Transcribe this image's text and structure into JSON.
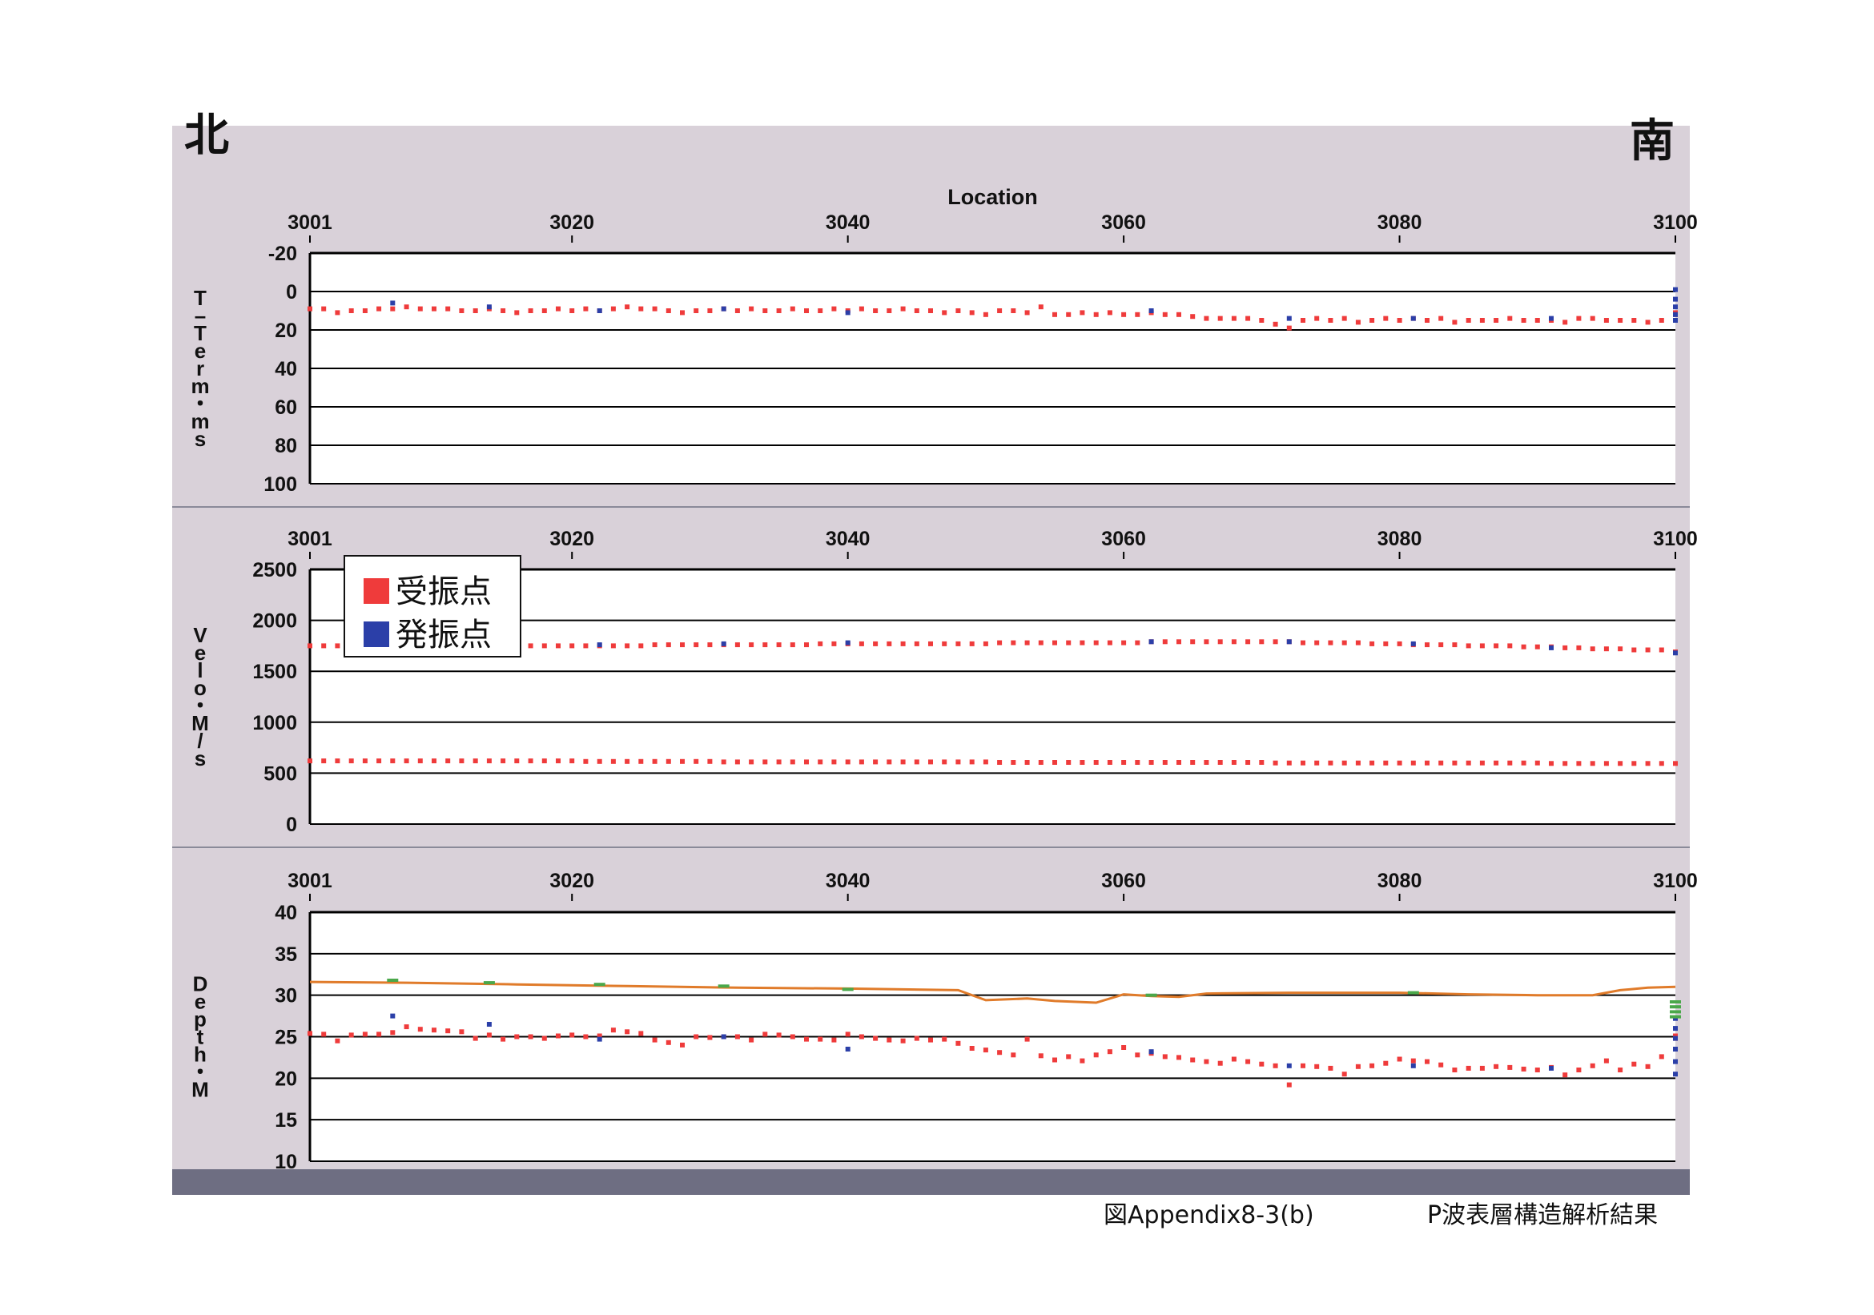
{
  "header": {
    "north_label": "北",
    "south_label": "南"
  },
  "caption": {
    "figure_id": "図Appendix8-3(b)",
    "figure_title": "P波表層構造解析結果"
  },
  "legend": {
    "items": [
      {
        "label": "受振点",
        "color": "#ef3b3b"
      },
      {
        "label": "発振点",
        "color": "#2b3fa8"
      }
    ]
  },
  "colors": {
    "receiver": "#ef3b3b",
    "shot": "#2b3fa8",
    "surface_line": "#e07b2a",
    "surface_marker": "#4aa84a",
    "panel_bg": "#d9d1d9",
    "plot_bg": "#ffffff",
    "footer_bar": "#6e6e82"
  },
  "chart_data": [
    {
      "type": "scatter",
      "title": "",
      "xlabel": "Location",
      "ylabel": "T-Term・ms",
      "x_ticks": [
        3001,
        3020,
        3040,
        3060,
        3080,
        3100
      ],
      "xlim": [
        3001,
        3100
      ],
      "y_ticks": [
        -20,
        0,
        20,
        40,
        60,
        80,
        100
      ],
      "ylim": [
        -20,
        100
      ],
      "y_inverted": true,
      "grid": true,
      "series": [
        {
          "name": "受振点",
          "x": [
            3001,
            3002,
            3003,
            3004,
            3005,
            3006,
            3007,
            3008,
            3009,
            3010,
            3011,
            3012,
            3013,
            3014,
            3015,
            3016,
            3017,
            3018,
            3019,
            3020,
            3021,
            3022,
            3023,
            3024,
            3025,
            3026,
            3027,
            3028,
            3029,
            3030,
            3031,
            3032,
            3033,
            3034,
            3035,
            3036,
            3037,
            3038,
            3039,
            3040,
            3041,
            3042,
            3043,
            3044,
            3045,
            3046,
            3047,
            3048,
            3049,
            3050,
            3051,
            3052,
            3053,
            3054,
            3055,
            3056,
            3057,
            3058,
            3059,
            3060,
            3061,
            3062,
            3063,
            3064,
            3065,
            3066,
            3067,
            3068,
            3069,
            3070,
            3071,
            3072,
            3073,
            3074,
            3075,
            3076,
            3077,
            3078,
            3079,
            3080,
            3081,
            3082,
            3083,
            3084,
            3085,
            3086,
            3087,
            3088,
            3089,
            3090,
            3091,
            3092,
            3093,
            3094,
            3095,
            3096,
            3097,
            3098,
            3099,
            3100
          ],
          "y": [
            9,
            9,
            11,
            10,
            10,
            9,
            9,
            8,
            9,
            9,
            9,
            10,
            10,
            9,
            10,
            11,
            10,
            10,
            9,
            10,
            9,
            10,
            9,
            8,
            9,
            9,
            10,
            11,
            10,
            10,
            9,
            10,
            9,
            10,
            10,
            9,
            10,
            10,
            9,
            10,
            9,
            10,
            10,
            9,
            10,
            10,
            11,
            10,
            11,
            12,
            10,
            10,
            11,
            8,
            12,
            12,
            11,
            12,
            11,
            12,
            12,
            11,
            12,
            12,
            13,
            14,
            14,
            14,
            14,
            15,
            17,
            19,
            15,
            14,
            15,
            14,
            16,
            15,
            14,
            15,
            14,
            15,
            14,
            16,
            15,
            15,
            15,
            14,
            15,
            15,
            15,
            16,
            14,
            14,
            15,
            15,
            15,
            16,
            15,
            12
          ],
          "extra_points": [
            [
              3100,
              11
            ]
          ]
        },
        {
          "name": "発振点",
          "x": [
            3007,
            3014,
            3022,
            3031,
            3040,
            3062,
            3072,
            3081,
            3091,
            3100,
            3100,
            3100,
            3100,
            3100
          ],
          "y": [
            6,
            8,
            10,
            9,
            11,
            10,
            14,
            14,
            14,
            -1,
            4,
            8,
            12,
            15
          ]
        }
      ]
    },
    {
      "type": "scatter",
      "title": "",
      "xlabel": "",
      "ylabel": "Velo・M/s",
      "x_ticks": [
        3001,
        3020,
        3040,
        3060,
        3080,
        3100
      ],
      "xlim": [
        3001,
        3100
      ],
      "y_ticks": [
        0,
        500,
        1000,
        1500,
        2000,
        2500
      ],
      "ylim": [
        0,
        2500
      ],
      "grid": true,
      "series": [
        {
          "name": "受振点",
          "x": [
            3001,
            3002,
            3003,
            3004,
            3005,
            3006,
            3007,
            3008,
            3009,
            3010,
            3011,
            3012,
            3013,
            3014,
            3015,
            3016,
            3017,
            3018,
            3019,
            3020,
            3021,
            3022,
            3023,
            3024,
            3025,
            3026,
            3027,
            3028,
            3029,
            3030,
            3031,
            3032,
            3033,
            3034,
            3035,
            3036,
            3037,
            3038,
            3039,
            3040,
            3041,
            3042,
            3043,
            3044,
            3045,
            3046,
            3047,
            3048,
            3049,
            3050,
            3051,
            3052,
            3053,
            3054,
            3055,
            3056,
            3057,
            3058,
            3059,
            3060,
            3061,
            3062,
            3063,
            3064,
            3065,
            3066,
            3067,
            3068,
            3069,
            3070,
            3071,
            3072,
            3073,
            3074,
            3075,
            3076,
            3077,
            3078,
            3079,
            3080,
            3081,
            3082,
            3083,
            3084,
            3085,
            3086,
            3087,
            3088,
            3089,
            3090,
            3091,
            3092,
            3093,
            3094,
            3095,
            3096,
            3097,
            3098,
            3099,
            3100
          ],
          "y": [
            1750,
            1750,
            1750,
            1750,
            1750,
            1750,
            1750,
            1750,
            1750,
            1750,
            1750,
            1750,
            1750,
            1750,
            1750,
            1750,
            1750,
            1750,
            1750,
            1750,
            1750,
            1750,
            1750,
            1750,
            1750,
            1760,
            1760,
            1760,
            1760,
            1760,
            1760,
            1760,
            1760,
            1760,
            1760,
            1760,
            1760,
            1770,
            1770,
            1770,
            1770,
            1770,
            1770,
            1770,
            1770,
            1770,
            1770,
            1770,
            1770,
            1770,
            1780,
            1780,
            1780,
            1780,
            1780,
            1780,
            1780,
            1780,
            1780,
            1780,
            1780,
            1790,
            1790,
            1790,
            1790,
            1790,
            1790,
            1790,
            1790,
            1790,
            1790,
            1790,
            1780,
            1780,
            1780,
            1780,
            1780,
            1770,
            1770,
            1770,
            1760,
            1760,
            1760,
            1760,
            1750,
            1750,
            1750,
            1750,
            1740,
            1740,
            1740,
            1730,
            1730,
            1720,
            1720,
            1720,
            1710,
            1710,
            1710,
            1690
          ]
        },
        {
          "name": "受振点 (second layer)",
          "x": [
            3001,
            3002,
            3003,
            3004,
            3005,
            3006,
            3007,
            3008,
            3009,
            3010,
            3011,
            3012,
            3013,
            3014,
            3015,
            3016,
            3017,
            3018,
            3019,
            3020,
            3021,
            3022,
            3023,
            3024,
            3025,
            3026,
            3027,
            3028,
            3029,
            3030,
            3031,
            3032,
            3033,
            3034,
            3035,
            3036,
            3037,
            3038,
            3039,
            3040,
            3041,
            3042,
            3043,
            3044,
            3045,
            3046,
            3047,
            3048,
            3049,
            3050,
            3051,
            3052,
            3053,
            3054,
            3055,
            3056,
            3057,
            3058,
            3059,
            3060,
            3061,
            3062,
            3063,
            3064,
            3065,
            3066,
            3067,
            3068,
            3069,
            3070,
            3071,
            3072,
            3073,
            3074,
            3075,
            3076,
            3077,
            3078,
            3079,
            3080,
            3081,
            3082,
            3083,
            3084,
            3085,
            3086,
            3087,
            3088,
            3089,
            3090,
            3091,
            3092,
            3093,
            3094,
            3095,
            3096,
            3097,
            3098,
            3099,
            3100
          ],
          "y": [
            620,
            620,
            620,
            620,
            620,
            620,
            620,
            620,
            620,
            620,
            620,
            620,
            620,
            620,
            620,
            620,
            620,
            620,
            620,
            620,
            615,
            615,
            615,
            615,
            615,
            615,
            615,
            615,
            615,
            615,
            610,
            610,
            610,
            610,
            610,
            610,
            610,
            610,
            610,
            610,
            610,
            610,
            610,
            610,
            610,
            610,
            610,
            610,
            610,
            610,
            605,
            605,
            605,
            605,
            605,
            605,
            605,
            605,
            605,
            605,
            605,
            605,
            605,
            605,
            605,
            605,
            605,
            605,
            605,
            605,
            600,
            600,
            600,
            600,
            600,
            600,
            600,
            600,
            600,
            600,
            600,
            600,
            600,
            600,
            600,
            600,
            600,
            600,
            600,
            600,
            595,
            595,
            595,
            595,
            595,
            595,
            595,
            595,
            595,
            595
          ]
        },
        {
          "name": "発振点",
          "x": [
            3022,
            3031,
            3040,
            3062,
            3072,
            3081,
            3091,
            3100
          ],
          "y": [
            1760,
            1770,
            1780,
            1790,
            1790,
            1770,
            1730,
            1680
          ]
        }
      ]
    },
    {
      "type": "scatter",
      "title": "",
      "xlabel": "",
      "ylabel": "Depth・M",
      "x_ticks": [
        3001,
        3020,
        3040,
        3060,
        3080,
        3100
      ],
      "xlim": [
        3001,
        3100
      ],
      "y_ticks": [
        10,
        15,
        20,
        25,
        30,
        35,
        40
      ],
      "ylim": [
        10,
        40
      ],
      "grid": true,
      "series": [
        {
          "name": "受振点",
          "x": [
            3001,
            3002,
            3003,
            3004,
            3005,
            3006,
            3007,
            3008,
            3009,
            3010,
            3011,
            3012,
            3013,
            3014,
            3015,
            3016,
            3017,
            3018,
            3019,
            3020,
            3021,
            3022,
            3023,
            3024,
            3025,
            3026,
            3027,
            3028,
            3029,
            3030,
            3031,
            3032,
            3033,
            3034,
            3035,
            3036,
            3037,
            3038,
            3039,
            3040,
            3041,
            3042,
            3043,
            3044,
            3045,
            3046,
            3047,
            3048,
            3049,
            3050,
            3051,
            3052,
            3053,
            3054,
            3055,
            3056,
            3057,
            3058,
            3059,
            3060,
            3061,
            3062,
            3063,
            3064,
            3065,
            3066,
            3067,
            3068,
            3069,
            3070,
            3071,
            3072,
            3073,
            3074,
            3075,
            3076,
            3077,
            3078,
            3079,
            3080,
            3081,
            3082,
            3083,
            3084,
            3085,
            3086,
            3087,
            3088,
            3089,
            3090,
            3091,
            3092,
            3093,
            3094,
            3095,
            3096,
            3097,
            3098,
            3099,
            3100
          ],
          "y": [
            25.4,
            25.3,
            24.5,
            25.2,
            25.3,
            25.3,
            25.5,
            26.2,
            25.9,
            25.8,
            25.7,
            25.6,
            24.8,
            25.2,
            24.7,
            25.0,
            25.0,
            24.8,
            25.1,
            25.2,
            25.0,
            25.1,
            25.8,
            25.6,
            25.4,
            24.6,
            24.3,
            24.0,
            25.0,
            24.9,
            25.0,
            25.0,
            24.6,
            25.3,
            25.2,
            25.0,
            24.7,
            24.7,
            24.6,
            25.3,
            25.0,
            24.8,
            24.6,
            24.5,
            24.8,
            24.6,
            24.7,
            24.2,
            23.6,
            23.4,
            23.1,
            22.8,
            24.7,
            22.7,
            22.2,
            22.6,
            22.1,
            22.8,
            23.2,
            23.7,
            22.8,
            23.0,
            22.6,
            22.5,
            22.2,
            22.0,
            21.8,
            22.3,
            22.0,
            21.7,
            21.5,
            19.2,
            21.5,
            21.4,
            21.2,
            20.5,
            21.4,
            21.5,
            21.8,
            22.3,
            22.1,
            22.0,
            21.6,
            21.0,
            21.2,
            21.2,
            21.4,
            21.3,
            21.1,
            21.0,
            21.3,
            20.4,
            21.0,
            21.5,
            22.1,
            21.0,
            21.7,
            21.4,
            22.6,
            25.1
          ],
          "extra_points": [
            [
              3100,
              24.8
            ]
          ]
        },
        {
          "name": "発振点",
          "x": [
            3007,
            3014,
            3022,
            3031,
            3040,
            3062,
            3072,
            3081,
            3091,
            3100,
            3100,
            3100,
            3100,
            3100,
            3100
          ],
          "y": [
            27.5,
            26.5,
            24.7,
            25.0,
            23.5,
            23.2,
            21.5,
            21.5,
            21.2,
            27.2,
            26.0,
            23.5,
            22.0,
            20.5,
            24.8
          ]
        },
        {
          "name": "surface",
          "x": [
            3001,
            3008,
            3016,
            3024,
            3032,
            3040,
            3048,
            3050,
            3053,
            3055,
            3058,
            3060,
            3062,
            3064,
            3066,
            3072,
            3080,
            3085,
            3090,
            3094,
            3096,
            3098,
            3100
          ],
          "y": [
            31.6,
            31.5,
            31.3,
            31.1,
            30.9,
            30.8,
            30.6,
            29.4,
            29.6,
            29.3,
            29.1,
            30.1,
            29.9,
            29.8,
            30.2,
            30.3,
            30.3,
            30.1,
            30.0,
            30.0,
            30.6,
            30.9,
            31.0
          ]
        },
        {
          "name": "surface markers",
          "x": [
            3007,
            3014,
            3022,
            3031,
            3040,
            3062,
            3081,
            3100,
            3100,
            3100,
            3100
          ],
          "y": [
            31.8,
            31.5,
            31.3,
            31.1,
            30.7,
            30.0,
            30.3,
            29.2,
            28.6,
            28.0,
            27.4
          ]
        }
      ]
    }
  ]
}
